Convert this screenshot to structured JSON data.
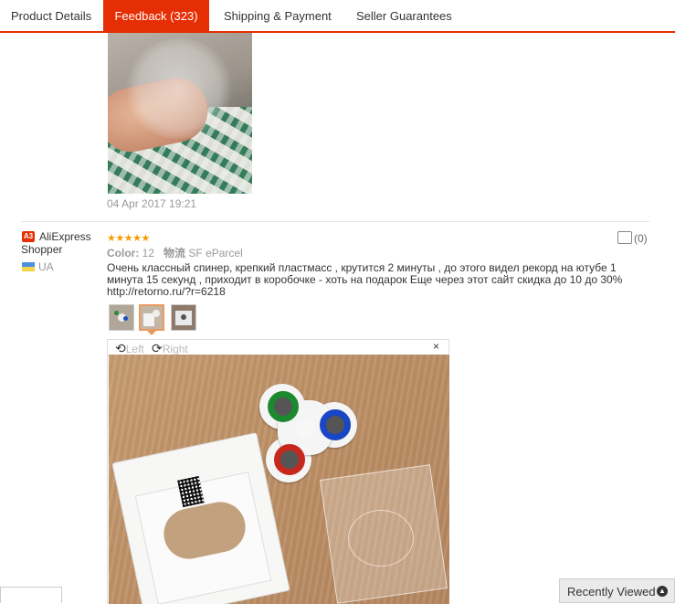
{
  "tabs": [
    {
      "label": "Product Details"
    },
    {
      "label": "Feedback (323)"
    },
    {
      "label": "Shipping & Payment"
    },
    {
      "label": "Seller Guarantees"
    }
  ],
  "active_tab": "Feedback (323)",
  "previous_review": {
    "date": "04 Apr 2017 19:21"
  },
  "review": {
    "badge": "A3",
    "reviewer_name": "AliExpress Shopper",
    "country": "UA",
    "stars": "★★★★★",
    "color_label": "Color:",
    "color_value": "12",
    "shipping_label": "物流",
    "shipping_value": "SF eParcel",
    "likes": "(0)",
    "text": "Очень классный спинер, крепкий пластмасс , крутится 2 минуты , до этого видел рекорд на ютубе 1 минута 15 секунд , приходит в коробочке - хоть на подарок Еще через этот сайт скидка до 10 до 30% http://retorno.ru/?r=6218"
  },
  "viewer": {
    "rotate_left": "Left",
    "rotate_right": "Right",
    "close": "×"
  },
  "recently_viewed": "Recently Viewed",
  "colors": {
    "accent": "#e62e04",
    "star": "#f59b00"
  }
}
